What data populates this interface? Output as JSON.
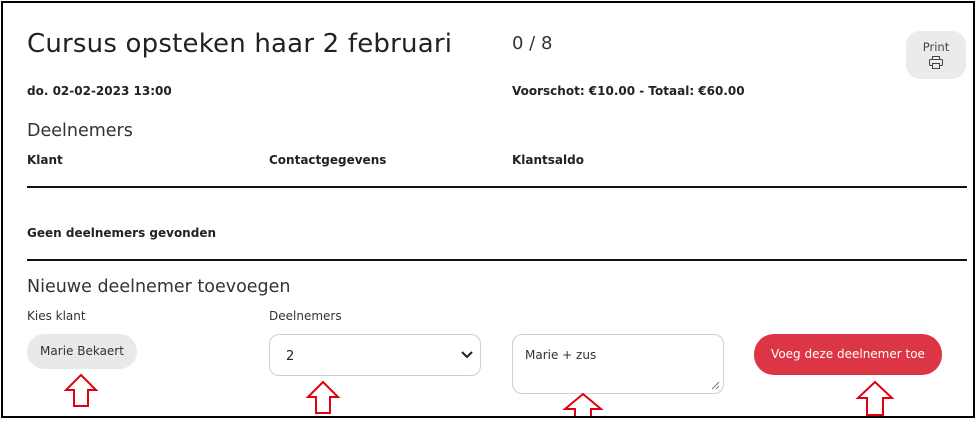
{
  "course": {
    "title": "Cursus opsteken haar 2 februari",
    "capacity": "0 / 8",
    "datetime": "do. 02-02-2023 13:00",
    "pricing": "Voorschot: €10.00 - Totaal: €60.00",
    "print_label": "Print"
  },
  "participants": {
    "heading": "Deelnemers",
    "columns": [
      "Klant",
      "Contactgegevens",
      "Klantsaldo"
    ],
    "empty_message": "Geen deelnemers gevonden"
  },
  "add_participant": {
    "heading": "Nieuwe deelnemer toevoegen",
    "client_label": "Kies klant",
    "client_value": "Marie Bekaert",
    "count_label": "Deelnemers",
    "count_value": "2",
    "note_value": "Marie + zus",
    "submit_label": "Voeg deze deelnemer toe"
  },
  "colors": {
    "accent": "#dc3545",
    "annotation_arrow": "#e0000f"
  },
  "icons": {
    "print": "printer-icon",
    "select": "chevron-down-icon",
    "annotation": "up-arrow-annotation-icon"
  }
}
